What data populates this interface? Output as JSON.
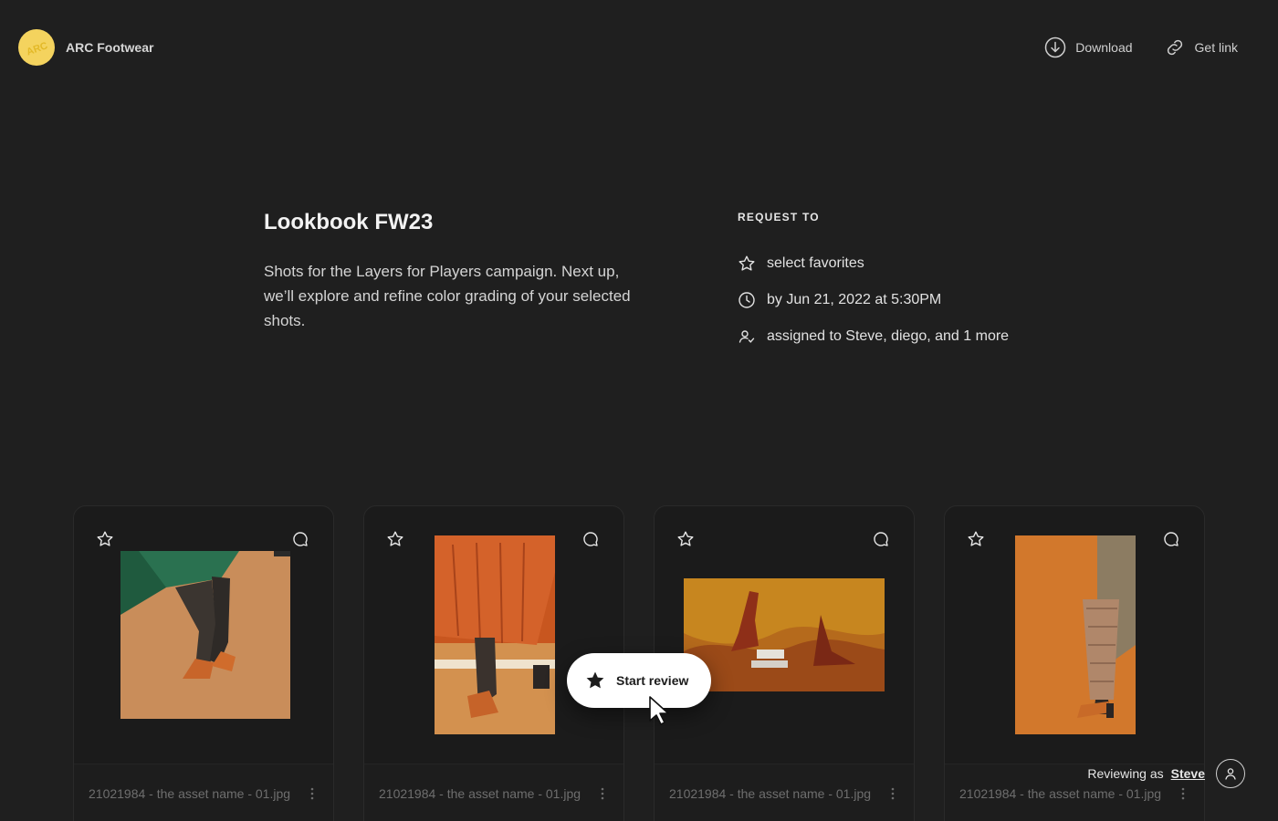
{
  "brand": {
    "name": "ARC Footwear",
    "logo_text": "ARC"
  },
  "header": {
    "download_label": "Download",
    "get_link_label": "Get link"
  },
  "request": {
    "title": "Lookbook FW23",
    "description": "Shots for the Layers for Players campaign. Next up, we’ll explore and refine color grading of your selected shots.",
    "heading": "REQUEST TO",
    "items": [
      {
        "icon": "star-icon",
        "text": "select favorites"
      },
      {
        "icon": "clock-icon",
        "text": "by Jun 21, 2022 at 5:30PM"
      },
      {
        "icon": "user-assign-icon",
        "text": "assigned to Steve, diego, and 1 more"
      }
    ]
  },
  "assets": [
    {
      "name": "21021984 - the asset name - 01.jpg"
    },
    {
      "name": "21021984 - the asset name - 01.jpg"
    },
    {
      "name": "21021984 - the asset name - 01.jpg"
    },
    {
      "name": "21021984 - the asset name - 01.jpg"
    }
  ],
  "start_review": {
    "label": "Start review"
  },
  "reviewer": {
    "prefix": "Reviewing as",
    "name": "Steve"
  },
  "colors": {
    "background": "#1f1f1f",
    "brand_yellow": "#f4d35e",
    "accent_orange": "#d9822b"
  }
}
